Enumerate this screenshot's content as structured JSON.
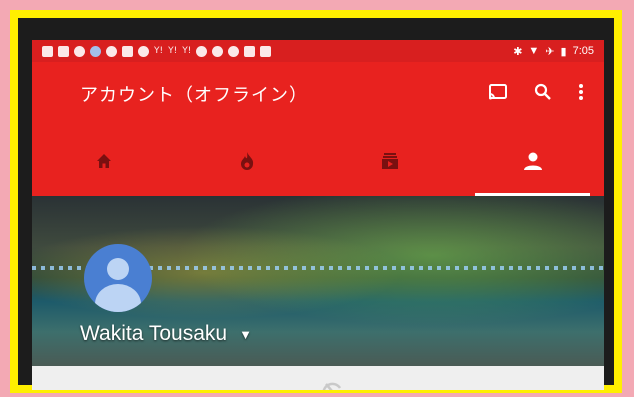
{
  "status_bar": {
    "time": "7:05",
    "notification_icons": [
      "facebook-icon",
      "facebook-icon",
      "record-icon",
      "info-icon",
      "record-icon",
      "square-icon",
      "record-icon",
      "yahoo-icon",
      "yahoo-icon",
      "yahoo-icon",
      "record-icon",
      "record-icon",
      "record-icon",
      "note-icon",
      "square-icon"
    ],
    "system_icons": [
      "bluetooth-icon",
      "wifi-icon",
      "airplane-icon",
      "battery-icon"
    ]
  },
  "app_bar": {
    "title": "アカウント（オフライン）",
    "actions": [
      "cast-icon",
      "search-icon",
      "more-vert-icon"
    ]
  },
  "tabs": [
    {
      "name": "home",
      "icon": "home-icon",
      "active": false
    },
    {
      "name": "trending",
      "icon": "flame-icon",
      "active": false
    },
    {
      "name": "subscriptions",
      "icon": "subscriptions-icon",
      "active": false
    },
    {
      "name": "account",
      "icon": "person-icon",
      "active": true
    }
  ],
  "profile": {
    "username": "Wakita Tousaku"
  },
  "colors": {
    "accent": "#e8221f",
    "statusbar": "#d81f1f",
    "avatar_bg": "#4a7fd2"
  }
}
